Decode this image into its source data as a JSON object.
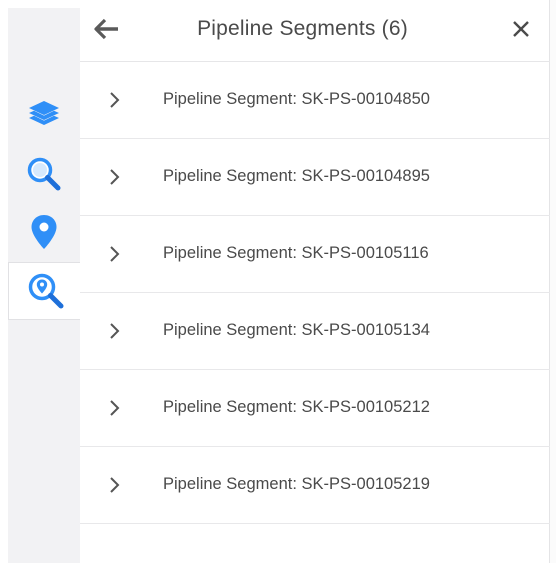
{
  "panel": {
    "title": "Pipeline Segments (6)",
    "items": [
      {
        "label": "Pipeline Segment: SK-PS-00104850"
      },
      {
        "label": "Pipeline Segment: SK-PS-00104895"
      },
      {
        "label": "Pipeline Segment: SK-PS-00105116"
      },
      {
        "label": "Pipeline Segment: SK-PS-00105134"
      },
      {
        "label": "Pipeline Segment: SK-PS-00105212"
      },
      {
        "label": "Pipeline Segment: SK-PS-00105219"
      }
    ]
  },
  "sidebar": {
    "buttons": [
      {
        "icon": "layers-icon"
      },
      {
        "icon": "search-icon"
      },
      {
        "icon": "location-pin-icon"
      },
      {
        "icon": "location-search-icon",
        "active": true
      }
    ]
  },
  "colors": {
    "accent": "#2f8ff7",
    "accent_dark": "#1e6fd9",
    "text": "#4a4a4a",
    "sidebar_bg": "#f2f2f4"
  }
}
